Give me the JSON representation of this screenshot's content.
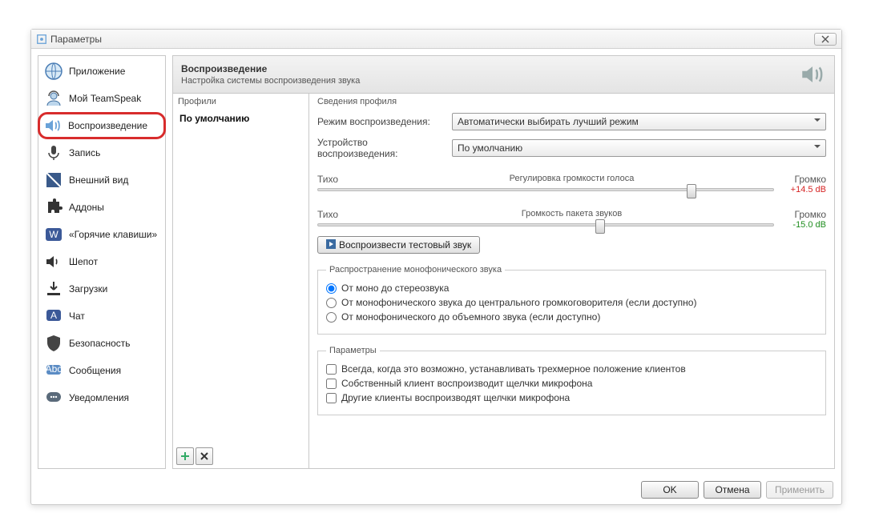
{
  "window": {
    "title": "Параметры"
  },
  "sidebar": {
    "items": [
      {
        "label": "Приложение"
      },
      {
        "label": "Мой TeamSpeak"
      },
      {
        "label": "Воспроизведение"
      },
      {
        "label": "Запись"
      },
      {
        "label": "Внешний вид"
      },
      {
        "label": "Аддоны"
      },
      {
        "label": "«Горячие клавиши»"
      },
      {
        "label": "Шепот"
      },
      {
        "label": "Загрузки"
      },
      {
        "label": "Чат"
      },
      {
        "label": "Безопасность"
      },
      {
        "label": "Сообщения"
      },
      {
        "label": "Уведомления"
      }
    ]
  },
  "section": {
    "title": "Воспроизведение",
    "subtitle": "Настройка системы воспроизведения звука"
  },
  "profiles": {
    "header": "Профили",
    "items": [
      {
        "name": "По умолчанию"
      }
    ]
  },
  "details": {
    "header": "Сведения профиля",
    "mode_label": "Режим воспроизведения:",
    "mode_value": "Автоматически выбирать лучший режим",
    "device_label": "Устройство воспроизведения:",
    "device_value": "По умолчанию",
    "slider1": {
      "left": "Тихо",
      "center": "Регулировка громкости голоса",
      "right": "Громко",
      "value": "+14.5 dB",
      "pos": 82
    },
    "slider2": {
      "left": "Тихо",
      "center": "Громкость пакета звуков",
      "right": "Громко",
      "value": "-15.0 dB",
      "pos": 62
    },
    "test_button": "Воспроизвести тестовый звук",
    "mono": {
      "legend": "Распространение монофонического звука",
      "opt1": "От моно до стереозвука",
      "opt2": "От монофонического звука до центрального громкоговорителя (если доступно)",
      "opt3": "От монофонического до объемного звука (если доступно)"
    },
    "params": {
      "legend": "Параметры",
      "chk1": "Всегда, когда это возможно, устанавливать трехмерное положение клиентов",
      "chk2": "Собственный клиент воспроизводит щелчки микрофона",
      "chk3": "Другие клиенты воспроизводят щелчки микрофона"
    }
  },
  "footer": {
    "ok": "OK",
    "cancel": "Отмена",
    "apply": "Применить"
  }
}
